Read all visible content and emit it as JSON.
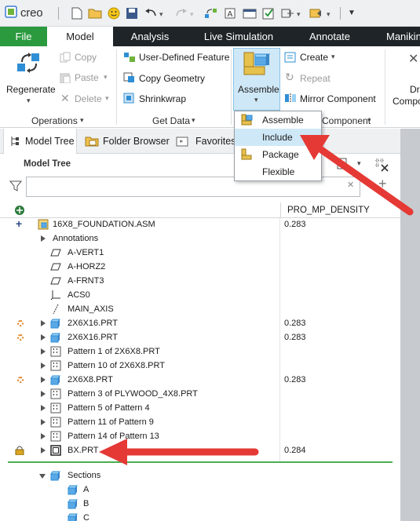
{
  "app": {
    "logo_text": "creo"
  },
  "quick_access": {
    "icons": [
      "new-file-icon",
      "open-folder-icon",
      "smiley-icon",
      "save-icon",
      "undo-icon",
      "redo-icon",
      "regenerate-icon",
      "annotation-icon",
      "window-icon",
      "checkbox-icon",
      "settings-icon",
      "more-icon"
    ]
  },
  "tabs": [
    {
      "label": "File"
    },
    {
      "label": "Model"
    },
    {
      "label": "Analysis"
    },
    {
      "label": "Live Simulation"
    },
    {
      "label": "Annotate"
    },
    {
      "label": "Manikin"
    }
  ],
  "ribbon": {
    "regenerate": "Regenerate",
    "copy": "Copy",
    "paste": "Paste",
    "delete": "Delete",
    "operations": "Operations",
    "user_defined_feature": "User-Defined Feature",
    "copy_geometry": "Copy Geometry",
    "shrinkwrap": "Shrinkwrap",
    "get_data": "Get Data",
    "assemble": "Assemble",
    "create": "Create",
    "repeat": "Repeat",
    "mirror_component": "Mirror Component",
    "component_group": "Component",
    "drag_components_line1": "Dr",
    "drag_components_line2": "Compo"
  },
  "assemble_menu": {
    "items": [
      {
        "label": "Assemble"
      },
      {
        "label": "Include"
      },
      {
        "label": "Package"
      },
      {
        "label": "Flexible"
      }
    ]
  },
  "navigator": {
    "tabs": [
      {
        "label": "Model Tree"
      },
      {
        "label": "Folder Browser"
      },
      {
        "label": "Favorites"
      }
    ],
    "title": "Model Tree",
    "search_value": "",
    "column_header": "PRO_MP_DENSITY"
  },
  "tree": {
    "root": {
      "label": "16X8_FOUNDATION.ASM",
      "value": "0.283"
    },
    "rows": [
      {
        "label": "Annotations",
        "value": ""
      },
      {
        "label": "A-VERT1",
        "value": ""
      },
      {
        "label": "A-HORZ2",
        "value": ""
      },
      {
        "label": "A-FRNT3",
        "value": ""
      },
      {
        "label": "ACS0",
        "value": ""
      },
      {
        "label": "MAIN_AXIS",
        "value": ""
      },
      {
        "label": "2X6X16.PRT",
        "value": "0.283"
      },
      {
        "label": "2X6X16.PRT",
        "value": "0.283"
      },
      {
        "label": "Pattern 1 of 2X6X8.PRT",
        "value": ""
      },
      {
        "label": "Pattern 10 of 2X6X8.PRT",
        "value": ""
      },
      {
        "label": "2X6X8.PRT",
        "value": "0.283"
      },
      {
        "label": "Pattern 3 of PLYWOOD_4X8.PRT",
        "value": ""
      },
      {
        "label": "Pattern 5 of Pattern 4",
        "value": ""
      },
      {
        "label": "Pattern 11 of Pattern 9",
        "value": ""
      },
      {
        "label": "Pattern 14 of Pattern 13",
        "value": ""
      },
      {
        "label": "BX.PRT",
        "value": "0.284"
      },
      {
        "label": "Sections",
        "value": ""
      },
      {
        "label": "A",
        "value": ""
      },
      {
        "label": "B",
        "value": ""
      },
      {
        "label": "C",
        "value": ""
      }
    ]
  },
  "colors": {
    "file_tab": "#2b9a3f",
    "tab_bar": "#1f2428",
    "highlight": "#cfe8f7",
    "arrow": "#e53935",
    "insert_line": "#4caf50"
  }
}
